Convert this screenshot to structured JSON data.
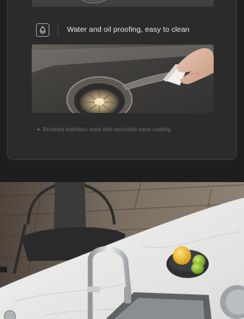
{
  "feature": {
    "title": "Water and oil proofing, easy to clean",
    "icon": "water-drop-shield-icon"
  },
  "footnote": {
    "text": "Brushed stainless steel sink excluded nano coating"
  },
  "images": {
    "previous": "sink-drain-closeup",
    "cleaning": "hand-wiping-sink-drain-with-cloth",
    "kitchen": "marble-countertop-with-faucet-lemons-and-sink"
  },
  "colors": {
    "background": "#1e1e1e",
    "card": "#2b2b2b",
    "text": "#e8e8e8",
    "muted": "#6f6f6f"
  }
}
